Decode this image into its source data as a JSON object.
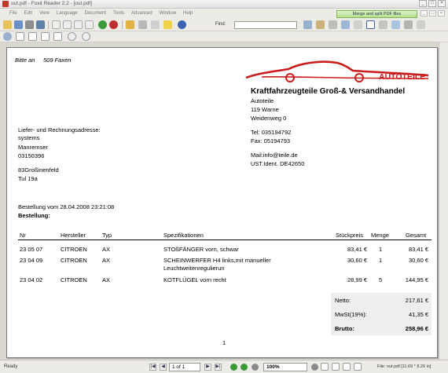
{
  "window": {
    "title": "out.pdf - Foxit Reader 2.2 - [out.pdf]",
    "minimize": "_",
    "maximize": "□",
    "close": "×"
  },
  "menu": {
    "items": [
      "File",
      "Edit",
      "View",
      "Language",
      "Document",
      "Tools",
      "Advanced",
      "Window",
      "Help"
    ],
    "promo": "Merge and split PDF files"
  },
  "toolbar": {
    "find_label": "Find:",
    "find_value": ""
  },
  "document": {
    "bitte_an": "Bitte an",
    "fax": "509 Faxen",
    "logo_text": "AUTOTEILE",
    "company_name": "Kraftfahrzeugteile Groß-& Versandhandel",
    "company_lines": [
      "Autoteile",
      "119 Warne",
      "Weidenweg 0"
    ],
    "tel": "Tel: 035194792",
    "fax_line": "Fax: 05194793",
    "mail": "Mail:info@teile.de",
    "ust": "UST.Ident. DE42650",
    "address_heading": "Liefer- und Rechnungsadresse:",
    "address_lines": [
      "systems",
      "Manremser",
      "03150396"
    ],
    "address_lines2": [
      "83Großinenfeld",
      "Tul 19a"
    ],
    "order_date": "Bestellung vom 28.04.2008 23:21:08",
    "order_heading": "Bestellung:",
    "columns": [
      "Nr",
      "Hersteller",
      "Typ",
      "Spezifikationen",
      "Stückpreis",
      "Menge",
      "Gesamt"
    ],
    "rows": [
      {
        "nr": "23 05 07",
        "hersteller": "CITROEN",
        "typ": "AX",
        "spec": "STOßFÄNGER vorn, schwar",
        "spec2": "",
        "preis": "83,41 €",
        "menge": "1",
        "gesamt": "83,41 €"
      },
      {
        "nr": "23 04 09",
        "hersteller": "CITROEN",
        "typ": "AX",
        "spec": "SCHEINWERFER H4 links,mit manueller",
        "spec2": "Leuchtweitenregulierun",
        "preis": "30,60 €",
        "menge": "1",
        "gesamt": "30,60 €"
      },
      {
        "nr": "23 04 02",
        "hersteller": "CITROEN",
        "typ": "AX",
        "spec": "KOTFLÜGEL vorn recht",
        "spec2": "",
        "preis": "28,99 €",
        "menge": "5",
        "gesamt": "144,95 €"
      }
    ],
    "totals": {
      "netto_label": "Netto:",
      "netto": "217,61 €",
      "mwst_label": "MwSt(19%):",
      "mwst": "41,35 €",
      "brutto_label": "Brutto:",
      "brutto": "258,96 €"
    },
    "page_number": "1"
  },
  "status": {
    "ready": "Ready",
    "page": "1 of 1",
    "zoom": "100%",
    "file_info": "File: out.pdf [11.69 * 8.26 in]"
  },
  "colors": {
    "logo_red": "#cc1b1b",
    "promo_green": "#b5df8e"
  }
}
